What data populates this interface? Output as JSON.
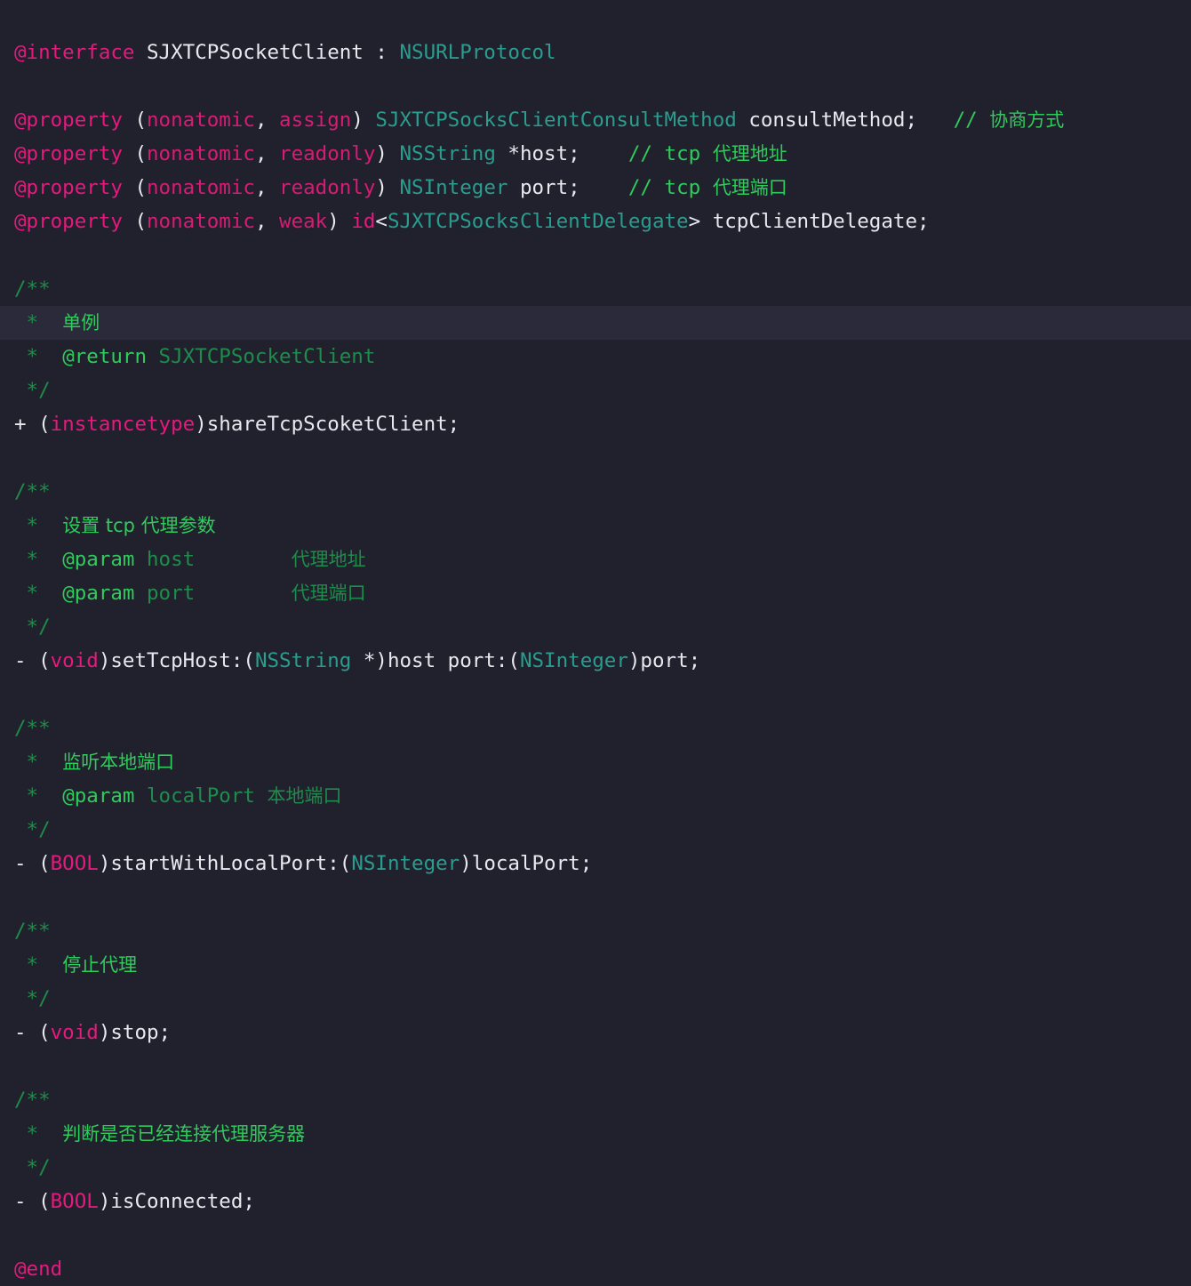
{
  "editor": {
    "language": "Objective-C",
    "file_kind": "header",
    "background_color": "#21212e",
    "highlight_line_color": "#2a2a3a",
    "default_text_color": "#e8e8ef",
    "highlighted_line_index": 7
  },
  "palette": {
    "keyword": "#e5197e",
    "attribute": "#d81b74",
    "type": "#2a9d8f",
    "comment": "#1e8c4a",
    "comment_bright": "#2ecc5a",
    "plain": "#e8e8ef"
  },
  "code": {
    "lines": [
      {
        "index": 0,
        "tokens": [
          {
            "text": "@interface",
            "kind": "keyword"
          },
          {
            "text": " SJXTCPSocketClient : ",
            "kind": "plain"
          },
          {
            "text": "NSURLProtocol",
            "kind": "type"
          }
        ]
      },
      {
        "index": 1,
        "tokens": []
      },
      {
        "index": 2,
        "tokens": [
          {
            "text": "@property",
            "kind": "keyword"
          },
          {
            "text": " (",
            "kind": "plain"
          },
          {
            "text": "nonatomic",
            "kind": "attribute"
          },
          {
            "text": ", ",
            "kind": "plain"
          },
          {
            "text": "assign",
            "kind": "attribute"
          },
          {
            "text": ") ",
            "kind": "plain"
          },
          {
            "text": "SJXTCPSocksClientConsultMethod",
            "kind": "type"
          },
          {
            "text": " consultMethod;   ",
            "kind": "plain"
          },
          {
            "text": "// ",
            "kind": "comment_bright"
          },
          {
            "text": "协商方式",
            "kind": "comment_bright_cjk"
          }
        ]
      },
      {
        "index": 3,
        "tokens": [
          {
            "text": "@property",
            "kind": "keyword"
          },
          {
            "text": " (",
            "kind": "plain"
          },
          {
            "text": "nonatomic",
            "kind": "attribute"
          },
          {
            "text": ", ",
            "kind": "plain"
          },
          {
            "text": "readonly",
            "kind": "attribute"
          },
          {
            "text": ") ",
            "kind": "plain"
          },
          {
            "text": "NSString",
            "kind": "type"
          },
          {
            "text": " *host;    ",
            "kind": "plain"
          },
          {
            "text": "// tcp ",
            "kind": "comment_bright"
          },
          {
            "text": "代理地址",
            "kind": "comment_bright_cjk"
          }
        ]
      },
      {
        "index": 4,
        "tokens": [
          {
            "text": "@property",
            "kind": "keyword"
          },
          {
            "text": " (",
            "kind": "plain"
          },
          {
            "text": "nonatomic",
            "kind": "attribute"
          },
          {
            "text": ", ",
            "kind": "plain"
          },
          {
            "text": "readonly",
            "kind": "attribute"
          },
          {
            "text": ") ",
            "kind": "plain"
          },
          {
            "text": "NSInteger",
            "kind": "type"
          },
          {
            "text": " port;    ",
            "kind": "plain"
          },
          {
            "text": "// tcp ",
            "kind": "comment_bright"
          },
          {
            "text": "代理端口",
            "kind": "comment_bright_cjk"
          }
        ]
      },
      {
        "index": 5,
        "tokens": [
          {
            "text": "@property",
            "kind": "keyword"
          },
          {
            "text": " (",
            "kind": "plain"
          },
          {
            "text": "nonatomic",
            "kind": "attribute"
          },
          {
            "text": ", ",
            "kind": "plain"
          },
          {
            "text": "weak",
            "kind": "attribute"
          },
          {
            "text": ") ",
            "kind": "plain"
          },
          {
            "text": "id",
            "kind": "keyword"
          },
          {
            "text": "<",
            "kind": "plain"
          },
          {
            "text": "SJXTCPSocksClientDelegate",
            "kind": "type"
          },
          {
            "text": "> tcpClientDelegate;",
            "kind": "plain"
          }
        ]
      },
      {
        "index": 6,
        "tokens": []
      },
      {
        "index": 7,
        "tokens": [
          {
            "text": "/**",
            "kind": "comment"
          }
        ]
      },
      {
        "index": 8,
        "highlighted": true,
        "tokens": [
          {
            "text": " *  ",
            "kind": "comment"
          },
          {
            "text": "单例",
            "kind": "comment_bright_cjk"
          }
        ]
      },
      {
        "index": 9,
        "tokens": [
          {
            "text": " *  ",
            "kind": "comment"
          },
          {
            "text": "@return",
            "kind": "comment_bright"
          },
          {
            "text": " SJXTCPSocketClient",
            "kind": "comment"
          }
        ]
      },
      {
        "index": 10,
        "tokens": [
          {
            "text": " */",
            "kind": "comment"
          }
        ]
      },
      {
        "index": 11,
        "tokens": [
          {
            "text": "+ (",
            "kind": "plain"
          },
          {
            "text": "instancetype",
            "kind": "keyword"
          },
          {
            "text": ")shareTcpScoketClient;",
            "kind": "plain"
          }
        ]
      },
      {
        "index": 12,
        "tokens": []
      },
      {
        "index": 13,
        "tokens": [
          {
            "text": "/**",
            "kind": "comment"
          }
        ]
      },
      {
        "index": 14,
        "tokens": [
          {
            "text": " *  ",
            "kind": "comment"
          },
          {
            "text": "设置 tcp 代理参数",
            "kind": "comment_bright_cjk"
          }
        ]
      },
      {
        "index": 15,
        "tokens": [
          {
            "text": " *  ",
            "kind": "comment"
          },
          {
            "text": "@param",
            "kind": "comment_bright"
          },
          {
            "text": " host",
            "kind": "comment"
          },
          {
            "text": "        ",
            "kind": "comment"
          },
          {
            "text": "代理地址",
            "kind": "comment_cjk"
          }
        ]
      },
      {
        "index": 16,
        "tokens": [
          {
            "text": " *  ",
            "kind": "comment"
          },
          {
            "text": "@param",
            "kind": "comment_bright"
          },
          {
            "text": " port",
            "kind": "comment"
          },
          {
            "text": "        ",
            "kind": "comment"
          },
          {
            "text": "代理端口",
            "kind": "comment_cjk"
          }
        ]
      },
      {
        "index": 17,
        "tokens": [
          {
            "text": " */",
            "kind": "comment"
          }
        ]
      },
      {
        "index": 18,
        "tokens": [
          {
            "text": "- (",
            "kind": "plain"
          },
          {
            "text": "void",
            "kind": "keyword"
          },
          {
            "text": ")setTcpHost:(",
            "kind": "plain"
          },
          {
            "text": "NSString",
            "kind": "type"
          },
          {
            "text": " *)host port:(",
            "kind": "plain"
          },
          {
            "text": "NSInteger",
            "kind": "type"
          },
          {
            "text": ")port;",
            "kind": "plain"
          }
        ]
      },
      {
        "index": 19,
        "tokens": []
      },
      {
        "index": 20,
        "tokens": [
          {
            "text": "/**",
            "kind": "comment"
          }
        ]
      },
      {
        "index": 21,
        "tokens": [
          {
            "text": " *  ",
            "kind": "comment"
          },
          {
            "text": "监听本地端口",
            "kind": "comment_bright_cjk"
          }
        ]
      },
      {
        "index": 22,
        "tokens": [
          {
            "text": " *  ",
            "kind": "comment"
          },
          {
            "text": "@param",
            "kind": "comment_bright"
          },
          {
            "text": " localPort ",
            "kind": "comment"
          },
          {
            "text": "本地端口",
            "kind": "comment_cjk"
          }
        ]
      },
      {
        "index": 23,
        "tokens": [
          {
            "text": " */",
            "kind": "comment"
          }
        ]
      },
      {
        "index": 24,
        "tokens": [
          {
            "text": "- (",
            "kind": "plain"
          },
          {
            "text": "BOOL",
            "kind": "keyword"
          },
          {
            "text": ")startWithLocalPort:(",
            "kind": "plain"
          },
          {
            "text": "NSInteger",
            "kind": "type"
          },
          {
            "text": ")localPort;",
            "kind": "plain"
          }
        ]
      },
      {
        "index": 25,
        "tokens": []
      },
      {
        "index": 26,
        "tokens": [
          {
            "text": "/**",
            "kind": "comment"
          }
        ]
      },
      {
        "index": 27,
        "tokens": [
          {
            "text": " *  ",
            "kind": "comment"
          },
          {
            "text": "停止代理",
            "kind": "comment_bright_cjk"
          }
        ]
      },
      {
        "index": 28,
        "tokens": [
          {
            "text": " */",
            "kind": "comment"
          }
        ]
      },
      {
        "index": 29,
        "tokens": [
          {
            "text": "- (",
            "kind": "plain"
          },
          {
            "text": "void",
            "kind": "keyword"
          },
          {
            "text": ")stop;",
            "kind": "plain"
          }
        ]
      },
      {
        "index": 30,
        "tokens": []
      },
      {
        "index": 31,
        "tokens": [
          {
            "text": "/**",
            "kind": "comment"
          }
        ]
      },
      {
        "index": 32,
        "tokens": [
          {
            "text": " *  ",
            "kind": "comment"
          },
          {
            "text": "判断是否已经连接代理服务器",
            "kind": "comment_bright_cjk"
          }
        ]
      },
      {
        "index": 33,
        "tokens": [
          {
            "text": " */",
            "kind": "comment"
          }
        ]
      },
      {
        "index": 34,
        "tokens": [
          {
            "text": "- (",
            "kind": "plain"
          },
          {
            "text": "BOOL",
            "kind": "keyword"
          },
          {
            "text": ")isConnected;",
            "kind": "plain"
          }
        ]
      },
      {
        "index": 35,
        "tokens": []
      },
      {
        "index": 36,
        "tokens": [
          {
            "text": "@end",
            "kind": "keyword"
          }
        ]
      }
    ]
  }
}
